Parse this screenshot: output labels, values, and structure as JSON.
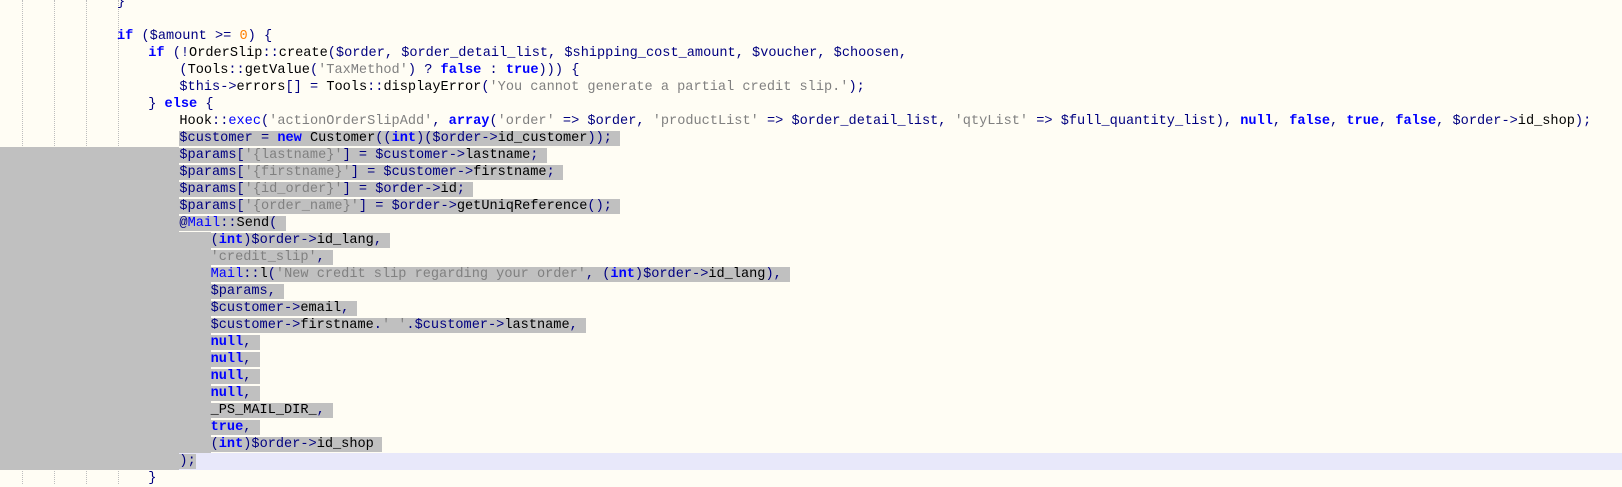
{
  "editor": {
    "lines": [
      {
        "indent": 2,
        "text": "}"
      },
      {
        "indent": 2,
        "text": ""
      },
      {
        "indent": 2,
        "text": "if ($amount >= 0) {"
      },
      {
        "indent": 3,
        "text": "if (!OrderSlip::create($order, $order_detail_list, $shipping_cost_amount, $voucher, $choosen,"
      },
      {
        "indent": 4,
        "text": "(Tools::getValue('TaxMethod') ? false : true))) {"
      },
      {
        "indent": 4,
        "text": "$this->errors[] = Tools::displayError('You cannot generate a partial credit slip.');"
      },
      {
        "indent": 3,
        "text": "} else {"
      },
      {
        "indent": 4,
        "text": "Hook::exec('actionOrderSlipAdd', array('order' => $order, 'productList' => $order_detail_list, 'qtyList' => $full_quantity_list), null, false, true, false, $order->id_shop);"
      },
      {
        "indent": 4,
        "text": "$customer = new Customer((int)($order->id_customer));",
        "selected": "partial"
      },
      {
        "indent": 4,
        "text": "$params['{lastname}'] = $customer->lastname;",
        "selected": "full"
      },
      {
        "indent": 4,
        "text": "$params['{firstname}'] = $customer->firstname;",
        "selected": "full"
      },
      {
        "indent": 4,
        "text": "$params['{id_order}'] = $order->id;",
        "selected": "full"
      },
      {
        "indent": 4,
        "text": "$params['{order_name}'] = $order->getUniqReference();",
        "selected": "full"
      },
      {
        "indent": 4,
        "text": "@Mail::Send(",
        "selected": "full"
      },
      {
        "indent": 5,
        "text": "(int)$order->id_lang,",
        "selected": "full"
      },
      {
        "indent": 5,
        "text": "'credit_slip',",
        "selected": "full"
      },
      {
        "indent": 5,
        "text": "Mail::l('New credit slip regarding your order', (int)$order->id_lang),",
        "selected": "full"
      },
      {
        "indent": 5,
        "text": "$params,",
        "selected": "full"
      },
      {
        "indent": 5,
        "text": "$customer->email,",
        "selected": "full"
      },
      {
        "indent": 5,
        "text": "$customer->firstname.' '.$customer->lastname,",
        "selected": "full"
      },
      {
        "indent": 5,
        "text": "null,",
        "selected": "full"
      },
      {
        "indent": 5,
        "text": "null,",
        "selected": "full"
      },
      {
        "indent": 5,
        "text": "null,",
        "selected": "full"
      },
      {
        "indent": 5,
        "text": "null,",
        "selected": "full"
      },
      {
        "indent": 5,
        "text": "_PS_MAIL_DIR_,",
        "selected": "full"
      },
      {
        "indent": 5,
        "text": "true,",
        "selected": "full"
      },
      {
        "indent": 5,
        "text": "(int)$order->id_shop",
        "selected": "full"
      },
      {
        "indent": 4,
        "text": ");",
        "selected": "full",
        "current": true
      },
      {
        "indent": 3,
        "text": "}"
      }
    ]
  },
  "colors": {
    "background": "#fffdf4",
    "selection": "#c0c0c0",
    "current_line": "#e8e8fa",
    "keyword": "#0000ff",
    "variable": "#000080",
    "string": "#808080",
    "number": "#ff8000"
  }
}
